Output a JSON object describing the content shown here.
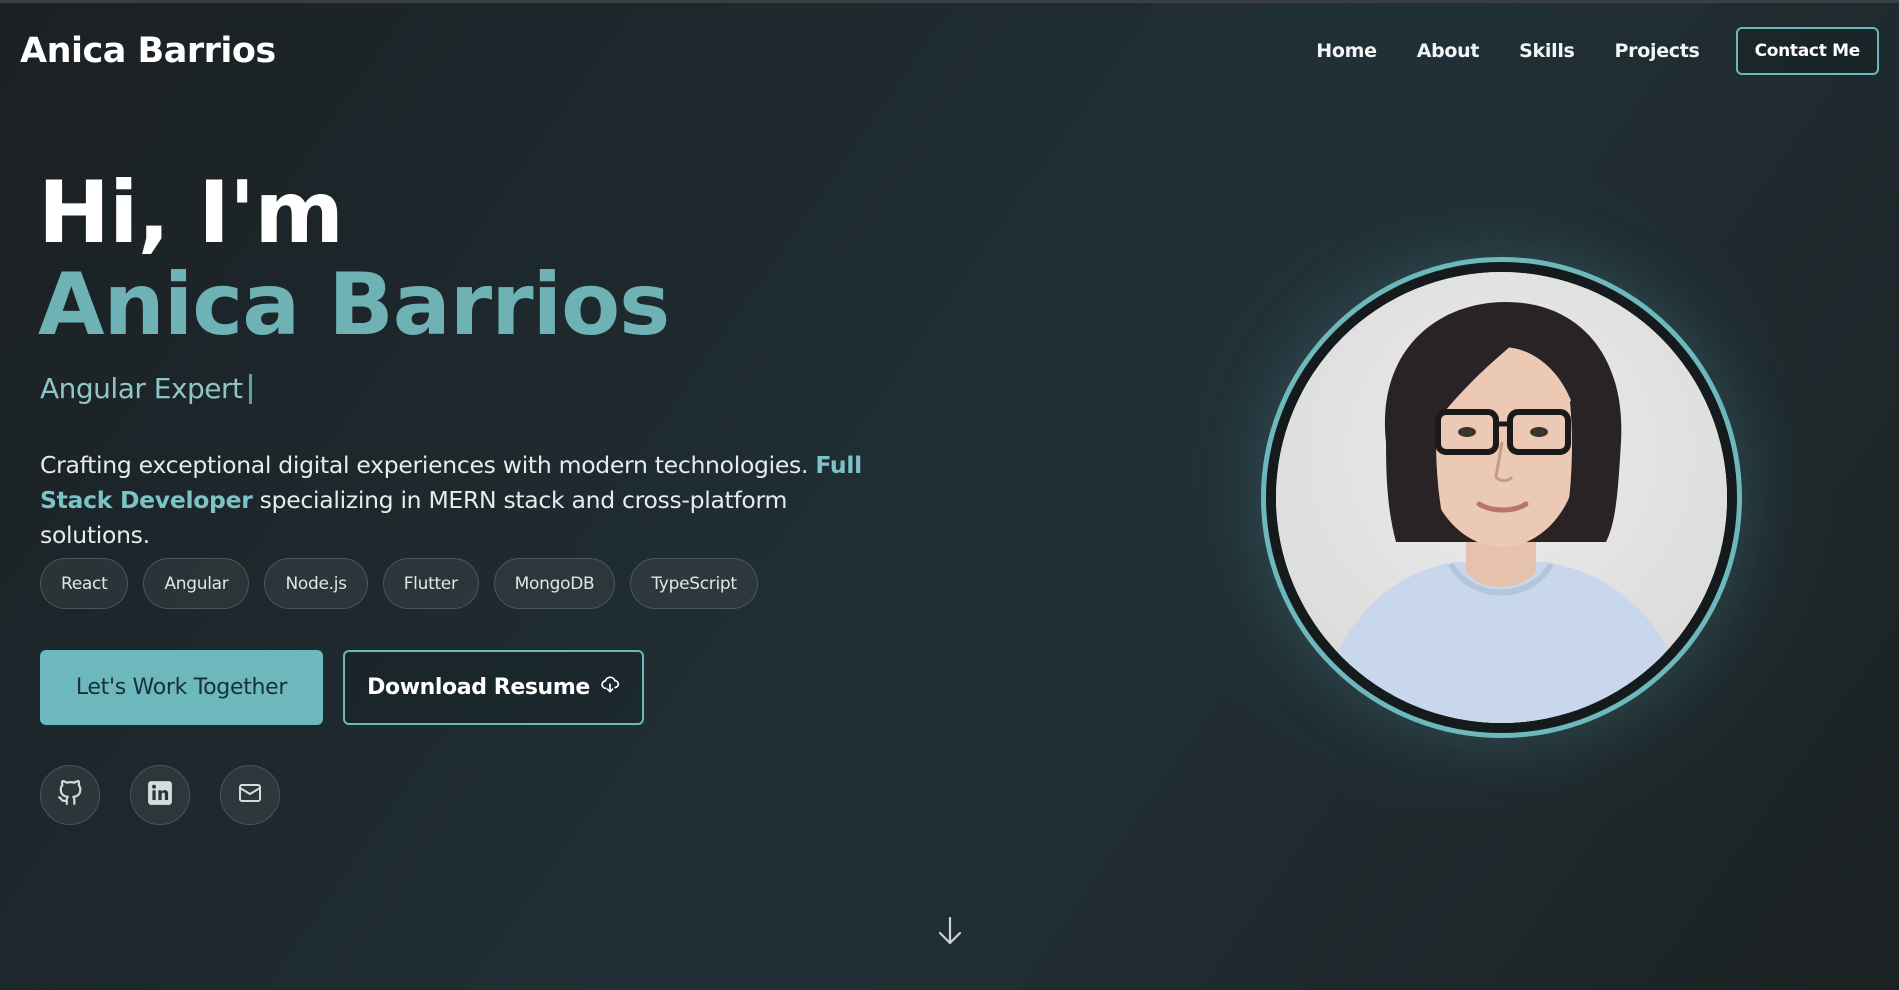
{
  "nav": {
    "brand": "Anica Barrios",
    "links": [
      "Home",
      "About",
      "Skills",
      "Projects"
    ],
    "contact_label": "Contact Me"
  },
  "hero": {
    "greeting": "Hi, I'm",
    "name": "Anica Barrios",
    "role": "Angular Expert",
    "description_part1": "Crafting exceptional digital experiences with modern technologies. ",
    "description_highlight": "Full Stack Developer",
    "description_part2": " specializing in MERN stack and cross-platform solutions.",
    "skills": [
      "React",
      "Angular",
      "Node.js",
      "Flutter",
      "MongoDB",
      "TypeScript"
    ],
    "primary_cta": "Let's Work Together",
    "secondary_cta": "Download Resume",
    "socials": [
      {
        "icon": "github-icon"
      },
      {
        "icon": "linkedin-icon"
      },
      {
        "icon": "mail-icon"
      }
    ]
  },
  "colors": {
    "accent": "#6cb8bc",
    "background": "#1c2326",
    "text": "#ffffff"
  }
}
